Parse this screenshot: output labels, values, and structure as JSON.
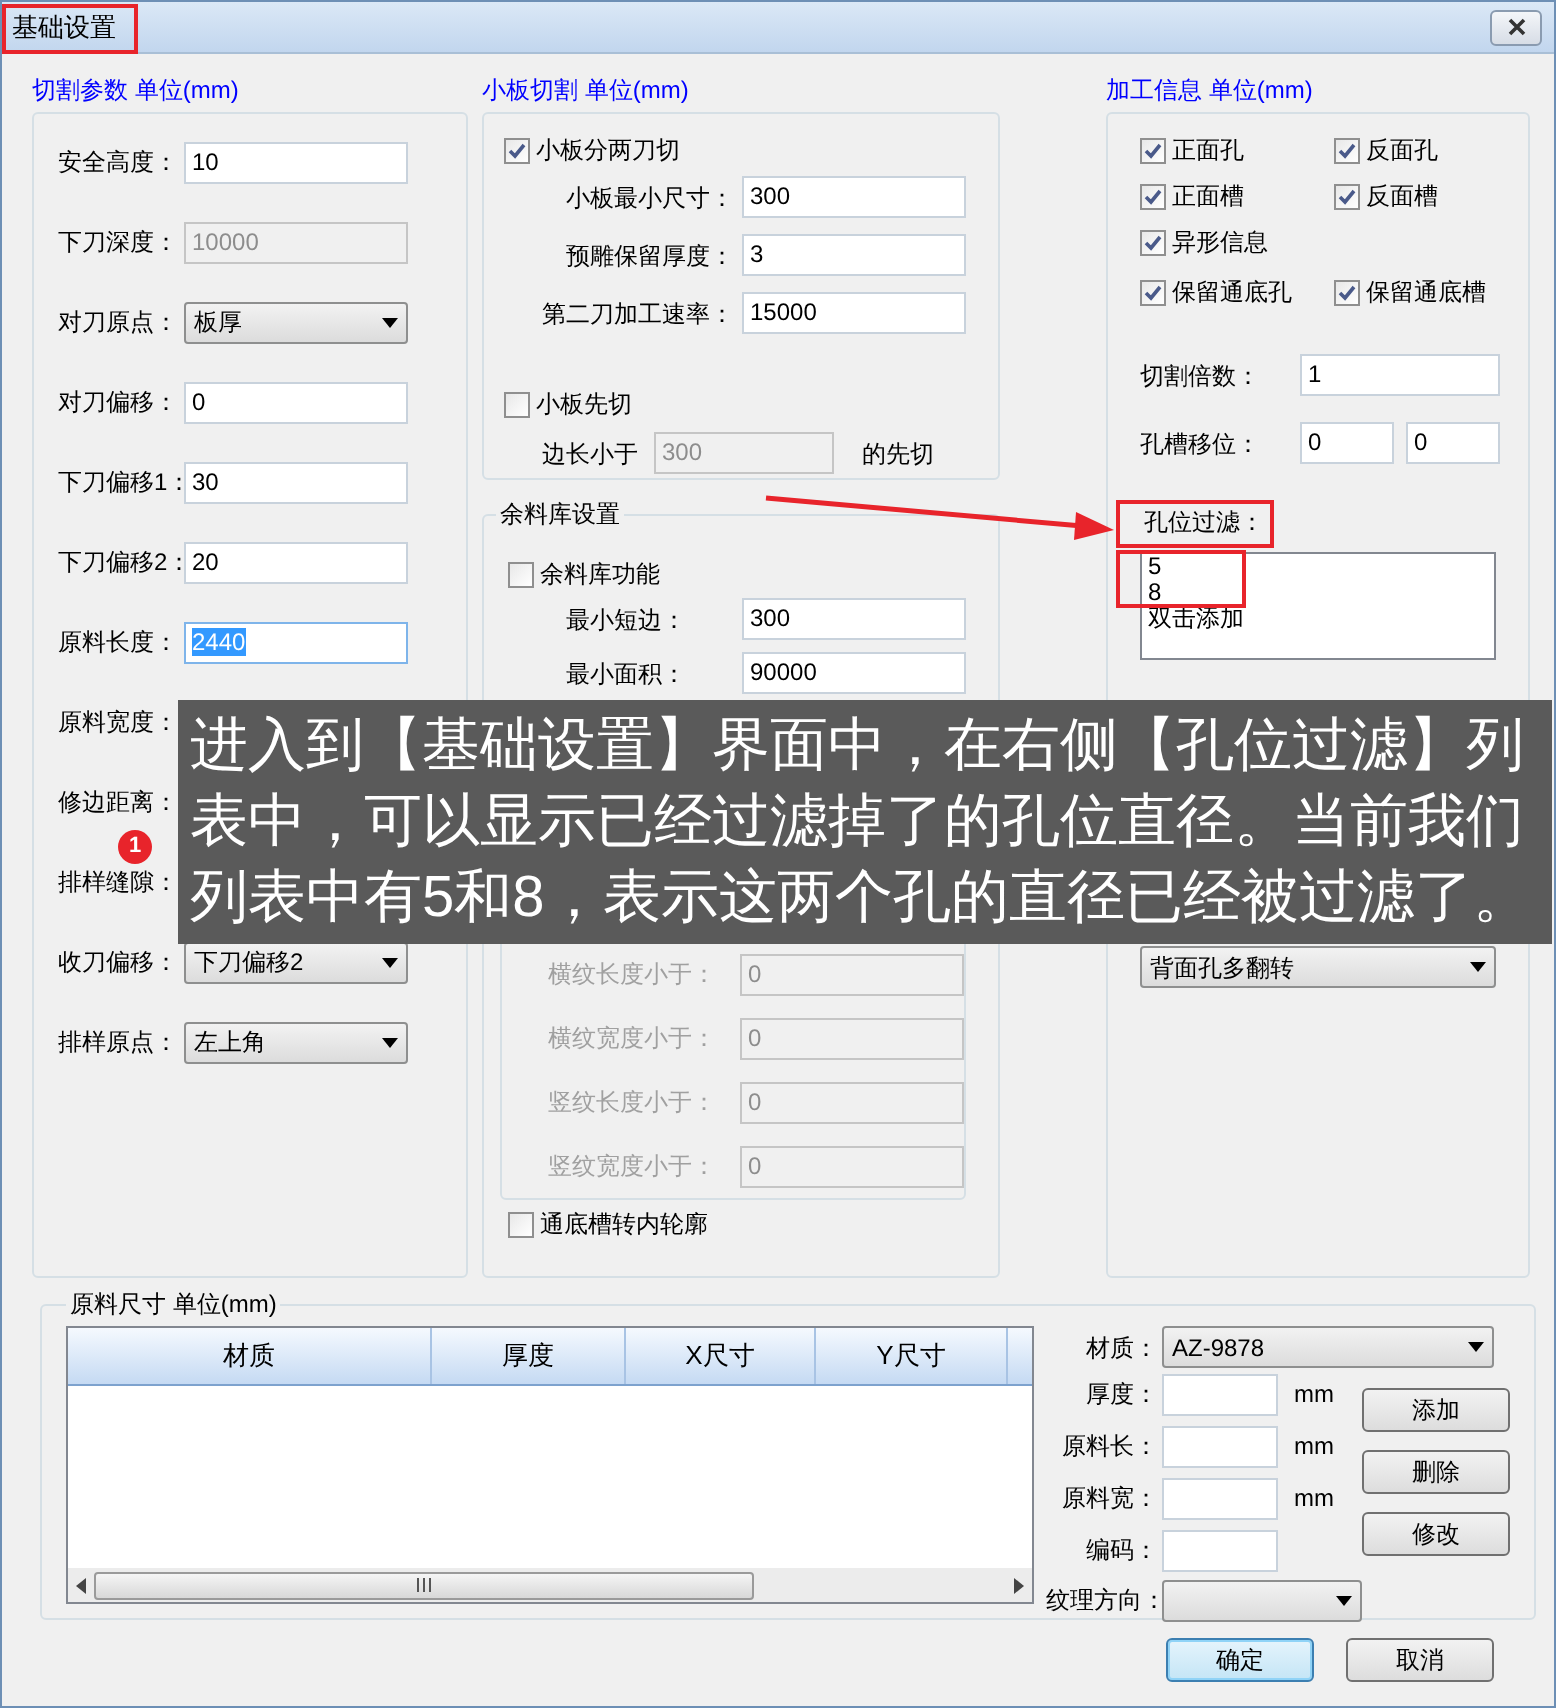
{
  "window": {
    "title": "基础设置"
  },
  "cutting": {
    "header": "切割参数 单位(mm)",
    "rows": [
      {
        "kind": "input",
        "label": "安全高度：",
        "value": "10",
        "disabled": false,
        "focused": false
      },
      {
        "kind": "input",
        "label": "下刀深度：",
        "value": "10000",
        "disabled": true,
        "focused": false
      },
      {
        "kind": "select",
        "label": "对刀原点：",
        "value": "板厚"
      },
      {
        "kind": "input",
        "label": "对刀偏移：",
        "value": "0",
        "disabled": false,
        "focused": false
      },
      {
        "kind": "input",
        "label": "下刀偏移1：",
        "value": "30",
        "disabled": false,
        "focused": false
      },
      {
        "kind": "input",
        "label": "下刀偏移2：",
        "value": "20",
        "disabled": false,
        "focused": false
      },
      {
        "kind": "input",
        "label": "原料长度：",
        "value": "2440",
        "disabled": false,
        "focused": true
      },
      {
        "kind": "label",
        "label": "原料宽度："
      },
      {
        "kind": "label",
        "label": "修边距离："
      },
      {
        "kind": "label",
        "label": "排样缝隙："
      },
      {
        "kind": "select",
        "label": "收刀偏移：",
        "value": "下刀偏移2"
      },
      {
        "kind": "select",
        "label": "排样原点：",
        "value": "左上角"
      }
    ]
  },
  "small_board": {
    "header": "小板切割 单位(mm)",
    "split": {
      "label": "小板分两刀切",
      "checked": true
    },
    "rows": [
      {
        "label": "小板最小尺寸：",
        "value": "300"
      },
      {
        "label": "预雕保留厚度：",
        "value": "3"
      },
      {
        "label": "第二刀加工速率：",
        "value": "15000"
      }
    ],
    "first": {
      "label": "小板先切",
      "checked": false
    },
    "first_row": {
      "prefix": "边长小于",
      "value": "300",
      "suffix": "的先切"
    }
  },
  "remnant": {
    "legend": "余料库设置",
    "enable": {
      "label": "余料库功能",
      "checked": false
    },
    "rows": [
      {
        "label": "最小短边：",
        "value": "300"
      },
      {
        "label": "最小面积：",
        "value": "90000"
      }
    ],
    "grain_rows": [
      {
        "label": "横纹长度小于：",
        "value": "0"
      },
      {
        "label": "横纹宽度小于：",
        "value": "0"
      },
      {
        "label": "竖纹长度小于：",
        "value": "0"
      },
      {
        "label": "竖纹宽度小于：",
        "value": "0"
      }
    ],
    "contour": {
      "label": "通底槽转内轮廓",
      "checked": false
    }
  },
  "processing": {
    "header": "加工信息 单位(mm)",
    "check_rows": [
      {
        "items": [
          {
            "label": "正面孔",
            "checked": true
          },
          {
            "label": "反面孔",
            "checked": true
          }
        ]
      },
      {
        "items": [
          {
            "label": "正面槽",
            "checked": true
          },
          {
            "label": "反面槽",
            "checked": true
          }
        ]
      },
      {
        "items": [
          {
            "label": "异形信息",
            "checked": true
          }
        ]
      },
      {
        "items": [
          {
            "label": "保留通底孔",
            "checked": true
          },
          {
            "label": "保留通底槽",
            "checked": true
          }
        ]
      }
    ],
    "multiple": {
      "label": "切割倍数：",
      "value": "1"
    },
    "shift": {
      "label": "孔槽移位：",
      "values": [
        "0",
        "0"
      ]
    },
    "filter": {
      "label": "孔位过滤：",
      "items": [
        "5",
        "8",
        "双击添加"
      ]
    },
    "flip": {
      "value": "背面孔多翻转"
    }
  },
  "stock": {
    "legend": "原料尺寸 单位(mm)",
    "columns": [
      "材质",
      "厚度",
      "X尺寸",
      "Y尺寸"
    ],
    "material": {
      "label": "材质：",
      "value": "AZ-9878"
    },
    "fields": [
      {
        "label": "厚度：",
        "unit": "mm"
      },
      {
        "label": "原料长：",
        "unit": "mm"
      },
      {
        "label": "原料宽：",
        "unit": "mm"
      },
      {
        "label": "编码："
      }
    ],
    "grain": {
      "label": "纹理方向："
    },
    "buttons": [
      "添加",
      "删除",
      "修改"
    ]
  },
  "footer": [
    {
      "label": "确定",
      "default": true
    },
    {
      "label": "取消",
      "default": false
    }
  ],
  "annotation": {
    "badge": "1",
    "caption": "进入到【基础设置】界面中，在右侧【孔位过滤】列表中，可以显示已经过滤掉了的孔位直径。当前我们列表中有5和8，表示这两个孔的直径已经被过滤了。"
  }
}
